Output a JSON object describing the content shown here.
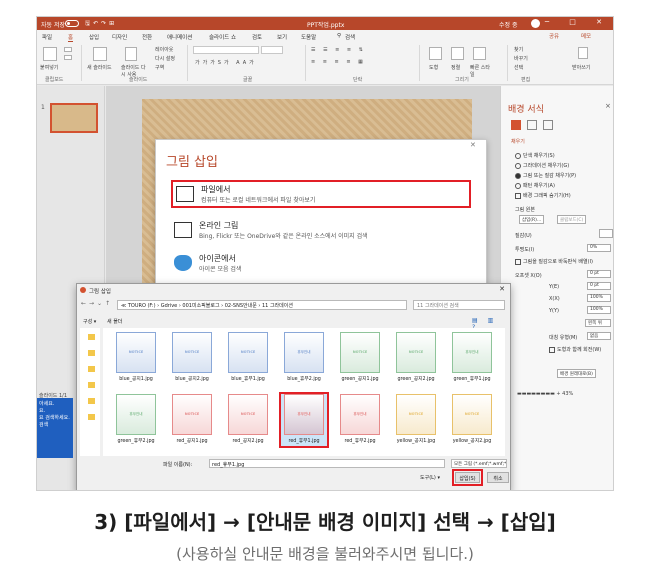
{
  "titlebar": {
    "autosave": "자동 저장",
    "document": "PPT작업.pptx",
    "user": "수정 중",
    "window_buttons": "─ □ ✕"
  },
  "menu": {
    "tabs": [
      "파일",
      "홈",
      "삽입",
      "디자인",
      "전환",
      "애니메이션",
      "슬라이드 쇼",
      "검토",
      "보기",
      "도움말",
      "검색"
    ],
    "share": "공유",
    "memo": "메모"
  },
  "ribbon": {
    "groups": [
      "클립보드",
      "슬라이드",
      "글꼴",
      "단락",
      "그리기",
      "편집"
    ],
    "paste": "붙여넣기",
    "new_slide": "새 슬라이드",
    "reuse_slide": "슬라이드 다시 사용",
    "layout": "레이아웃",
    "reset": "다시 설정",
    "section": "구역",
    "shape": "도형",
    "arrange": "정렬",
    "quick_style": "빠른 스타일",
    "find": "찾기",
    "replace": "바꾸기",
    "select": "선택",
    "dictate": "받아쓰기"
  },
  "thumbnails": {
    "slide_number": "1"
  },
  "format_pane": {
    "title": "배경 서식",
    "section": "채우기",
    "fill_options": [
      "단색 채우기(S)",
      "그라데이션 채우기(G)",
      "그림 또는 질감 채우기(P)",
      "패턴 채우기(A)"
    ],
    "selected_fill": 2,
    "hide_bg_graphics": "배경 그래픽 숨기기(H)",
    "picture_source": "그림 원본",
    "insert_btn": "삽입(R)...",
    "clipboard_btn": "클립보드(C)",
    "texture": "질감(U)",
    "transparency": "투명도(I)",
    "transparency_value": "0%",
    "tile": "그림을 질감으로 바둑판식 배열(I)",
    "offsets": [
      {
        "label": "오프셋 X(O)",
        "value": "0 pt"
      },
      {
        "label": "Y(E)",
        "value": "0 pt"
      },
      {
        "label": "X(X)",
        "value": "100%"
      },
      {
        "label": "Y(Y)",
        "value": "100%"
      }
    ],
    "alignment_label": "왼쪽 위",
    "mirror_label": "대칭 유형(M)",
    "mirror_value": "없음",
    "rotate_with_shape": "도형과 함께 회전(W)",
    "reset_bg": "배경 원래대로(B)"
  },
  "insert_dialog": {
    "title": "그림 삽입",
    "options": [
      {
        "name": "파일에서",
        "desc": "컴퓨터 또는 로컬 네트워크에서 파일 찾아보기"
      },
      {
        "name": "온라인 그림",
        "desc": "Bing, Flickr 또는 OneDrive와 같은 온라인 소스에서 이미지 검색"
      },
      {
        "name": "아이콘에서",
        "desc": "아이콘 모음 검색"
      }
    ]
  },
  "file_dialog": {
    "title": "그림 삽입",
    "address": "≪ TOURO (F:) › Gdrive › 001미소픽블로그 › 02-SNS안내문 › 11 그라데이션",
    "search_placeholder": "11 그라데이션 검색",
    "organize": "구성 ▾",
    "new_folder": "새 폴더",
    "files": [
      {
        "name": "blue_공지1.jpg",
        "color": "#8aa8d8",
        "text": "NOTICE"
      },
      {
        "name": "blue_공지2.jpg",
        "color": "#8aa8d8",
        "text": "NOTICE"
      },
      {
        "name": "blue_휴무1.jpg",
        "color": "#8aa8d8",
        "text": "NOTICE"
      },
      {
        "name": "blue_휴무2.jpg",
        "color": "#8aa8d8",
        "text": "휴무안내"
      },
      {
        "name": "green_공지1.jpg",
        "color": "#8fc49a",
        "text": "NOTICE"
      },
      {
        "name": "green_공지2.jpg",
        "color": "#8fc49a",
        "text": "NOTICE"
      },
      {
        "name": "green_휴무1.jpg",
        "color": "#8fc49a",
        "text": "휴무안내"
      },
      {
        "name": "green_휴무2.jpg",
        "color": "#8fc49a",
        "text": "휴무안내"
      },
      {
        "name": "red_공지1.jpg",
        "color": "#e68a8a",
        "text": "NOTICE"
      },
      {
        "name": "red_공지2.jpg",
        "color": "#e68a8a",
        "text": "NOTICE"
      },
      {
        "name": "red_휴무1.jpg",
        "color": "#e68a8a",
        "text": "휴무안내"
      },
      {
        "name": "red_휴무2.jpg",
        "color": "#e68a8a",
        "text": "휴무안내"
      },
      {
        "name": "yellow_공지1.jpg",
        "color": "#e8c16a",
        "text": "NOTICE"
      },
      {
        "name": "yellow_공지2.jpg",
        "color": "#e8c16a",
        "text": "NOTICE"
      }
    ],
    "selected_file": 10,
    "filename_label": "파일 이름(N):",
    "filename_value": "red_휴무1.jpg",
    "filetype": "모든 그림 (*.emf;*.wmf;*.jpg;*",
    "tools": "도구(L) ▾",
    "insert_btn": "삽입(S)",
    "cancel_btn": "취소"
  },
  "status": {
    "slide_count": "슬라이드 1/1",
    "zoom": "43%"
  },
  "side_panel": {
    "lines": [
      "아세요.",
      "요.",
      "요 검색하세요.",
      "",
      "검색"
    ]
  },
  "caption": {
    "line1": "3) [파일에서] → [안내문 배경 이미지] 선택 → [삽입]",
    "line2": "(사용하실 안내문 배경을 불러와주시면 됩니다.)"
  }
}
